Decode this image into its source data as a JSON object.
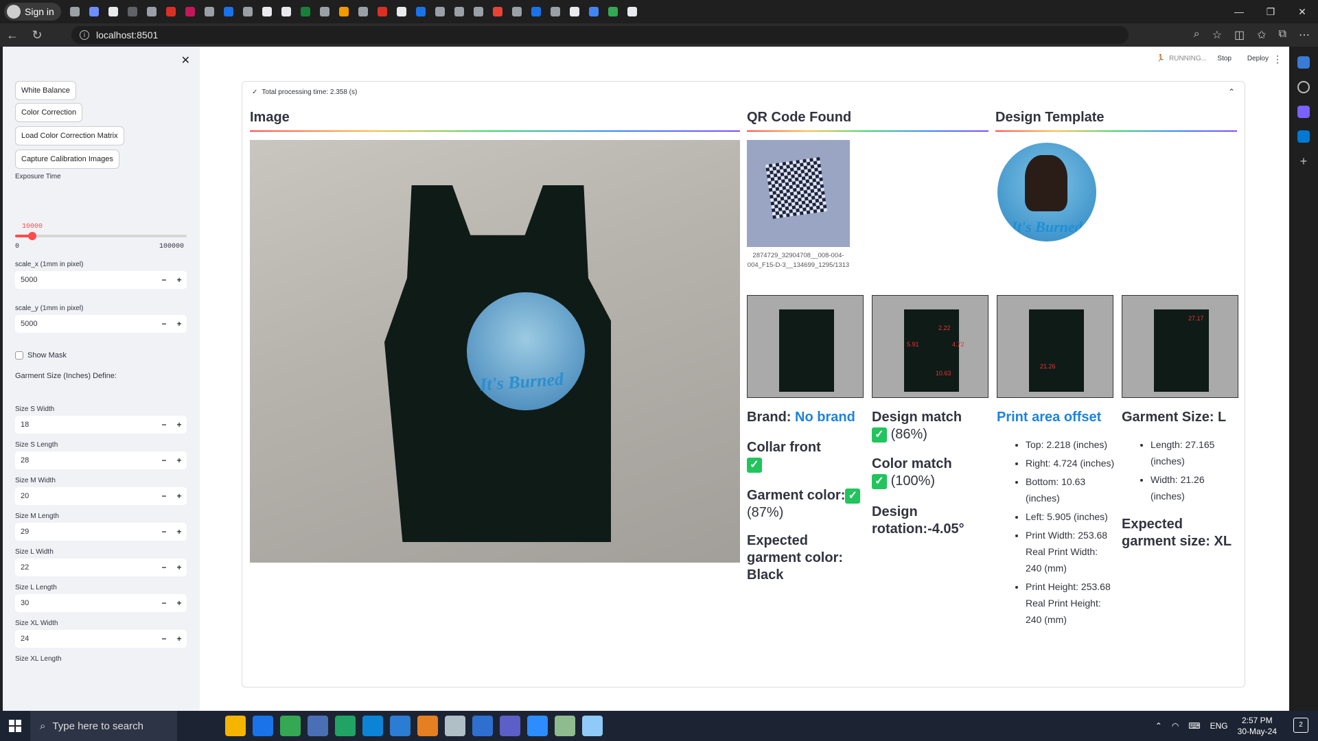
{
  "browser": {
    "profile_label": "Sign in",
    "url": "localhost:8501",
    "tab_icon_colors": [
      "#9aa0a6",
      "#6e8efb",
      "#e8eaed",
      "#5f6368",
      "#9aa0a6",
      "#d93025",
      "#c2185b",
      "#9aa0a6",
      "#1a73e8",
      "#9aa0a6",
      "#e8eaed",
      "#e8eaed",
      "#188038",
      "#9aa0a6",
      "#f29900",
      "#9aa0a6",
      "#d93025",
      "#e8eaed",
      "#1a73e8",
      "#9aa0a6",
      "#9aa0a6",
      "#9aa0a6",
      "#ea4335",
      "#9aa0a6",
      "#1a73e8",
      "#9aa0a6",
      "#e8eaed",
      "#4285f4",
      "#34a853",
      "#e8eaed"
    ]
  },
  "header": {
    "status": "RUNNING...",
    "stop_label": "Stop",
    "deploy_label": "Deploy"
  },
  "sidebar": {
    "buttons": [
      "White Balance",
      "Color Correction",
      "Load Color Correction Matrix",
      "Capture Calibration Images"
    ],
    "exposure": {
      "label": "Exposure Time",
      "value": "10000",
      "min": "0",
      "max": "100000",
      "fraction": 0.1
    },
    "scale_x": {
      "label": "scale_x (1mm in pixel)",
      "value": "5000"
    },
    "scale_y": {
      "label": "scale_y (1mm in pixel)",
      "value": "5000"
    },
    "show_mask": "Show Mask",
    "garment_heading": "Garment Size (Inches) Define:",
    "sizes": [
      {
        "label": "Size S Width",
        "value": "18"
      },
      {
        "label": "Size S Length",
        "value": "28"
      },
      {
        "label": "Size M Width",
        "value": "20"
      },
      {
        "label": "Size M Length",
        "value": "29"
      },
      {
        "label": "Size L Width",
        "value": "22"
      },
      {
        "label": "Size L Length",
        "value": "30"
      },
      {
        "label": "Size XL Width",
        "value": "24"
      },
      {
        "label": "Size XL Length",
        "value": ""
      }
    ],
    "stepper_minus": "−",
    "stepper_plus": "+"
  },
  "main": {
    "processing_time": "Total processing time: 2.358 (s)",
    "col_image": "Image",
    "col_qr": "QR Code Found",
    "col_template": "Design Template",
    "qr_caption": "2874729_32904708__008-004-004_F15-D-3__134699_1295/1313",
    "brand_label": "Brand:",
    "brand_value": "No brand",
    "collar": "Collar front",
    "garment_color": "Garment color:",
    "garment_color_pct": "(87%)",
    "expected_color": "Expected garment color: Black",
    "design_match": "Design match",
    "design_match_pct": "(86%)",
    "color_match": "Color match",
    "color_match_pct": "(100%)",
    "design_rotation": "Design rotation:-4.05°",
    "print_area_offset": "Print area offset",
    "offsets": [
      "Top: 2.218 (inches)",
      "Right: 4.724 (inches)",
      "Bottom: 10.63 (inches)",
      "Left: 5.905 (inches)",
      "Print Width: 253.68 Real Print Width: 240 (mm)",
      "Print Height: 253.68 Real Print Height: 240 (mm)"
    ],
    "garment_size": "Garment Size: L",
    "size_details": [
      "Length: 27.165 (inches)",
      "Width: 21.26 (inches)"
    ],
    "expected_size": "Expected garment size: XL",
    "thumb_labels": [
      "5.91",
      "4.72",
      "2.22",
      "10.63",
      "21.26",
      "27.17"
    ],
    "design_text": "It's Burned"
  },
  "taskbar": {
    "search_placeholder": "Type here to search",
    "lang": "ENG",
    "time": "2:57 PM",
    "date": "30-May-24",
    "notifications": "2",
    "app_colors": [
      "#f4b400",
      "#1a73e8",
      "#34a853",
      "#4a6fb5",
      "#21a366",
      "#0b84d8",
      "#2b7cd3",
      "#e67e22",
      "#b0bec5",
      "#2f6fd0",
      "#5b5fc7",
      "#2d8cff",
      "#8fbc8f",
      "#90caf9"
    ]
  }
}
